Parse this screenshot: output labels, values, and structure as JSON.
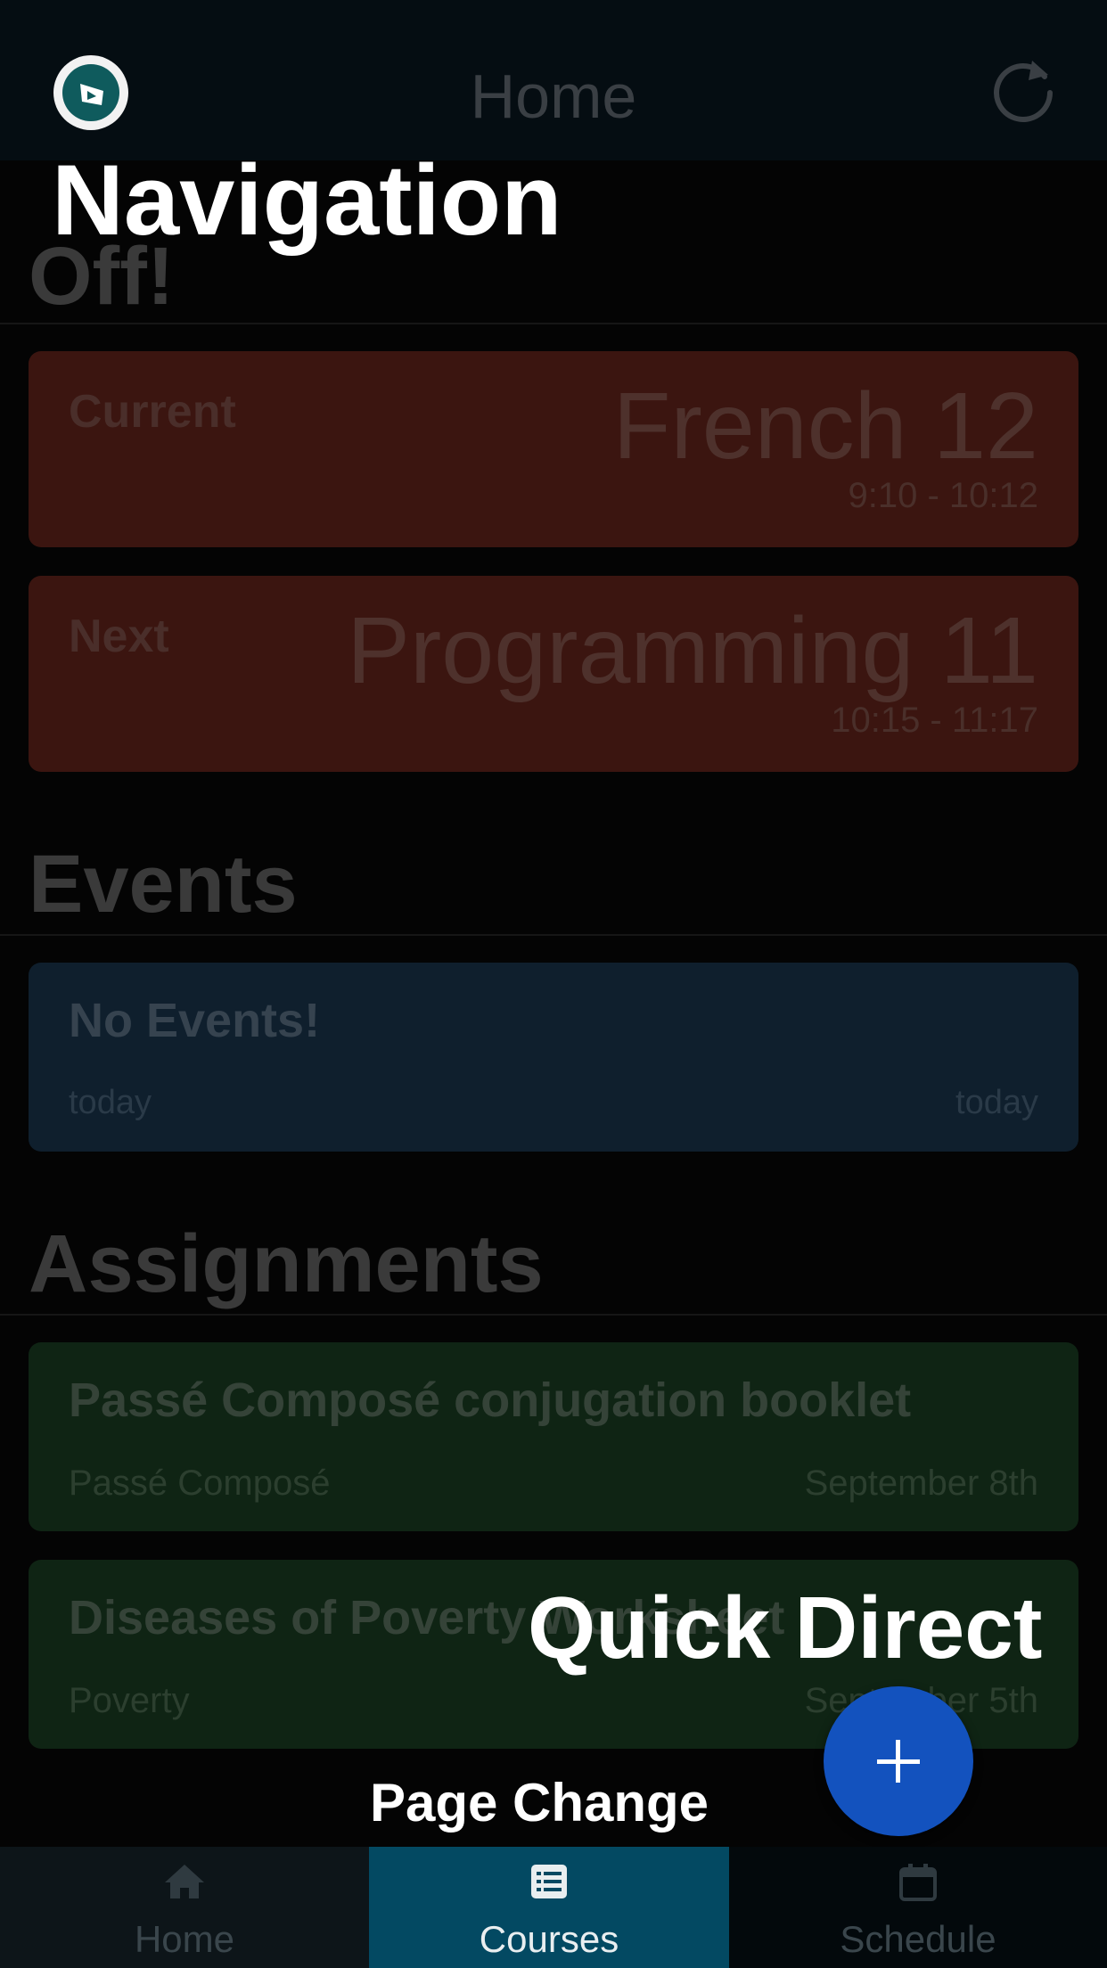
{
  "header": {
    "title": "Home",
    "logo_icon": "app-logo-icon",
    "refresh_icon": "refresh-icon"
  },
  "schedule": {
    "section_title": "Off!",
    "current": {
      "label": "Current",
      "course": "French 12",
      "time": "9:10 - 10:12"
    },
    "next": {
      "label": "Next",
      "course": "Programming 11",
      "time": "10:15 - 11:17"
    }
  },
  "events": {
    "section_title": "Events",
    "items": [
      {
        "title": "No Events!",
        "start": "today",
        "end": "today"
      }
    ]
  },
  "assignments": {
    "section_title": "Assignments",
    "items": [
      {
        "title": "Passé Composé conjugation booklet",
        "topic": "Passé Composé",
        "due": "September 8th"
      },
      {
        "title": "Diseases of Poverty Worksheet",
        "topic": "Poverty",
        "due": "September 5th"
      }
    ]
  },
  "tutorial": {
    "navigation": "Navigation",
    "quick_direct": "Quick Direct",
    "page_change": "Page Change"
  },
  "fab": {
    "icon": "plus-icon"
  },
  "bottom_nav": {
    "active": "Courses",
    "tabs": [
      {
        "label": "Home",
        "icon": "home-icon"
      },
      {
        "label": "Courses",
        "icon": "list-icon"
      },
      {
        "label": "Schedule",
        "icon": "calendar-icon"
      }
    ]
  },
  "colors": {
    "current_card": "#3b1510",
    "event_card": "#0f1f2d",
    "assignment_card": "#0f2414",
    "fab": "#1352be",
    "active_tab": "#034962",
    "overlay_text": "#ffffff"
  }
}
